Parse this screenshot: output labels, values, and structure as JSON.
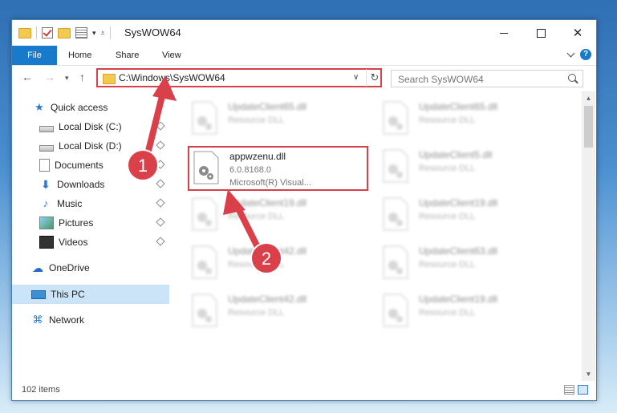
{
  "window": {
    "title": "SysWOW64"
  },
  "ribbon": {
    "tabs": [
      "File",
      "Home",
      "Share",
      "View"
    ],
    "help": "?"
  },
  "address": {
    "path": "C:\\Windows\\SysWOW64",
    "refresh_glyph": "↻"
  },
  "search": {
    "placeholder": "Search SysWOW64"
  },
  "nav": {
    "items": [
      {
        "label": "Quick access",
        "icon": "star-icon"
      },
      {
        "label": "Local Disk (C:)",
        "icon": "disk-icon",
        "pinned": true
      },
      {
        "label": "Local Disk (D:)",
        "icon": "disk-icon",
        "pinned": true
      },
      {
        "label": "Documents",
        "icon": "documents-icon",
        "pinned": true
      },
      {
        "label": "Downloads",
        "icon": "downloads-icon",
        "pinned": true
      },
      {
        "label": "Music",
        "icon": "music-icon",
        "pinned": true
      },
      {
        "label": "Pictures",
        "icon": "pictures-icon",
        "pinned": true
      },
      {
        "label": "Videos",
        "icon": "videos-icon",
        "pinned": true
      },
      {
        "label": "OneDrive",
        "icon": "onedrive-icon"
      },
      {
        "label": "This PC",
        "icon": "pc-icon",
        "selected": true
      },
      {
        "label": "Network",
        "icon": "network-icon"
      }
    ]
  },
  "files": [
    {
      "name": "UpdateClient65.dll",
      "type": "Resource DLL"
    },
    {
      "name": "UpdateClient65.dll",
      "type": "Resource DLL"
    },
    {
      "name": "appwzenu.dll",
      "version": "6.0.8168.0",
      "company": "Microsoft(R) Visual...",
      "highlighted": true
    },
    {
      "name": "UpdateClient5.dll",
      "type": "Resource DLL"
    },
    {
      "name": "UpdateClient19.dll",
      "type": "Resource DLL"
    },
    {
      "name": "UpdateClient19.dll",
      "type": "Resource DLL"
    },
    {
      "name": "UpdateClient42.dll",
      "type": "Resource DLL"
    },
    {
      "name": "UpdateClient63.dll",
      "type": "Resource DLL"
    },
    {
      "name": "UpdateClient42.dll",
      "type": "Resource DLL"
    },
    {
      "name": "UpdateClient19.dll",
      "type": "Resource DLL"
    }
  ],
  "status": {
    "count": "102 items"
  },
  "annotations": {
    "step1": "1",
    "step2": "2",
    "color": "#d9404a"
  }
}
